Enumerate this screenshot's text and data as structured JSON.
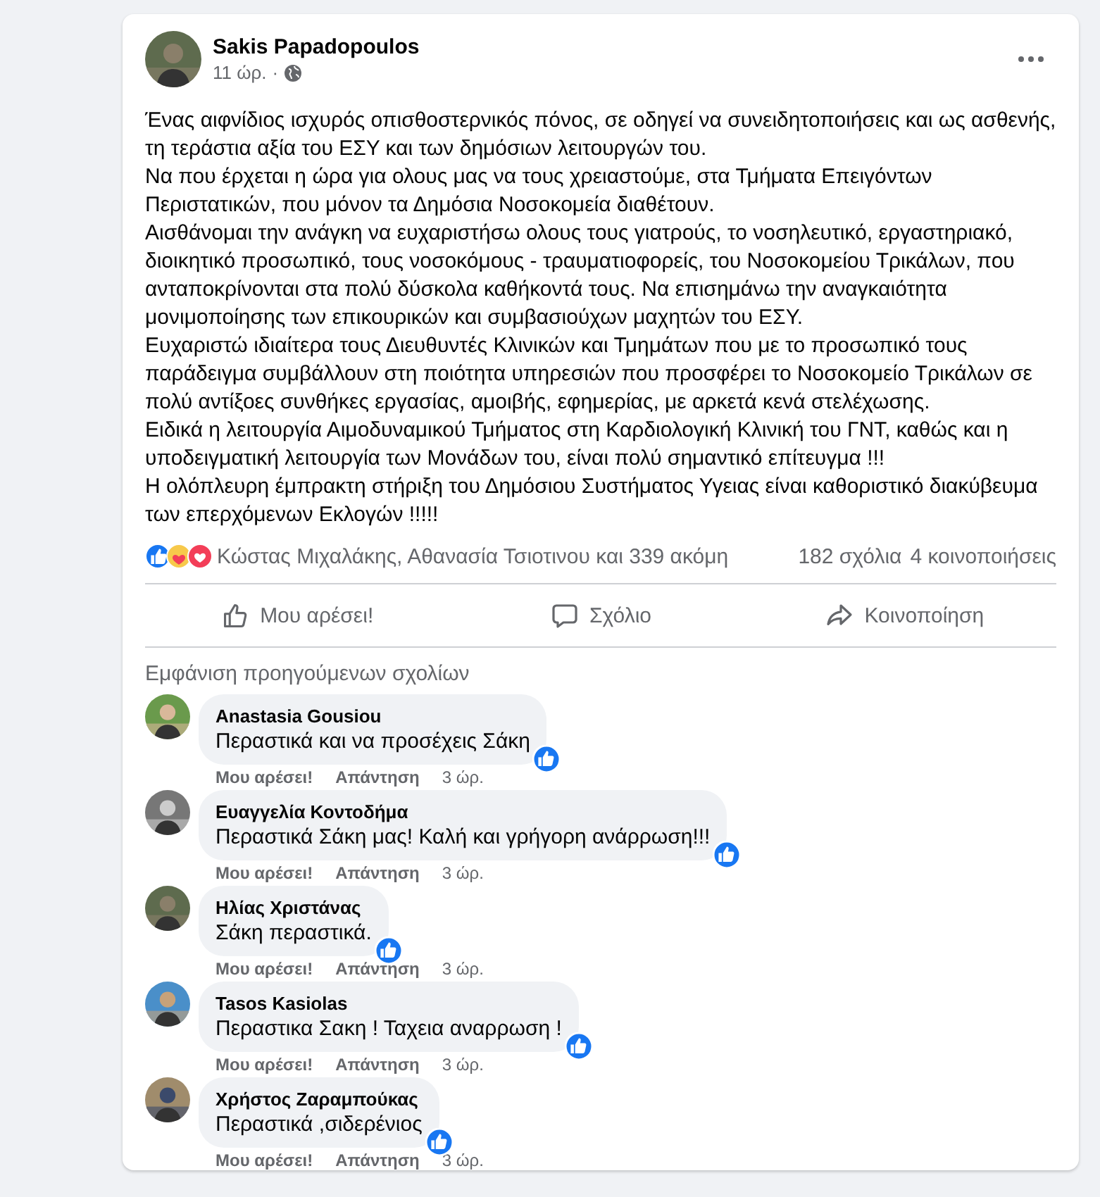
{
  "post": {
    "author": "Sakis Papadopoulos",
    "time": "11 ώρ.",
    "separator": "·",
    "paragraphs": [
      "Ένας αιφνίδιος ισχυρός οπισθοστερνικός πόνος, σε οδηγεί να συνειδητοποιήσεις και ως ασθενής, τη τεράστια αξία του ΕΣΥ και των δημόσιων λειτουργών του.",
      "Να που έρχεται η ώρα για ολους μας να τους χρειαστούμε, στα Τμήματα Επειγόντων Περιστατικών, που μόνον τα Δημόσια Νοσοκομεία διαθέτουν.",
      "Αισθάνομαι την ανάγκη να ευχαριστήσω ολους τους γιατρούς, το νοσηλευτικό, εργαστηριακό, διοικητικό προσωπικό, τους νοσοκόμους - τραυματιοφορείς, του Νοσοκομείου Τρικάλων, που ανταποκρίνονται στα πολύ δύσκολα καθήκοντά τους. Να επισημάνω την αναγκαιότητα μονιμοποίησης των επικουρικών και συμβασιούχων μαχητών του ΕΣΥ.",
      "Ευχαριστώ ιδιαίτερα τους Διευθυντές Κλινικών και Τμημάτων που με το προσωπικό τους παράδειγμα συμβάλλουν στη ποιότητα υπηρεσιών που προσφέρει το Νοσοκομείο Τρικάλων σε πολύ αντίξοες συνθήκες εργασίας, αμοιβής, εφημερίας, με αρκετά κενά στελέχωσης.",
      "Ειδικά η λειτουργία Αιμοδυναμικού Τμήματος στη Καρδιολογική Κλινική του ΓΝΤ, καθώς και η υποδειγματική λειτουργία των Μονάδων του, είναι πολύ σημαντικό επίτευγμα !!!",
      "Η ολόπλευρη έμπρακτη στήριξη του Δημόσιου Συστήματος Υγειας είναι καθοριστικό διακύβευμα των επερχόμενων Εκλογών !!!!!"
    ],
    "reactions": {
      "icons": [
        {
          "kind": "like"
        },
        {
          "kind": "care"
        },
        {
          "kind": "love"
        }
      ],
      "names": "Κώστας Μιχαλάκης, Αθανασία Τσιοτινου και 339 ακόμη",
      "comments": "182 σχόλια",
      "shares": "4 κοινοποιήσεις"
    },
    "actions": [
      {
        "kind": "like",
        "label": "Μου αρέσει!"
      },
      {
        "kind": "comment",
        "label": "Σχόλιο"
      },
      {
        "kind": "share",
        "label": "Κοινοποίηση"
      }
    ]
  },
  "previous_comments_link": "Εμφάνιση προηγούμενων σχολίων",
  "comments": [
    {
      "author": "Anastasia Gousiou",
      "text": "Περαστικά και να προσέχεις Σάκη",
      "like": "Μου αρέσει!",
      "reply": "Απάντηση",
      "time": "3 ώρ."
    },
    {
      "author": "Ευαγγελία Κοντοδήμα",
      "text": "Περαστικά Σάκη μας! Καλή και γρήγορη ανάρρωση!!!",
      "like": "Μου αρέσει!",
      "reply": "Απάντηση",
      "time": "3 ώρ."
    },
    {
      "author": "Ηλίας Χριστάνας",
      "text": "Σάκη περαστικά.",
      "like": "Μου αρέσει!",
      "reply": "Απάντηση",
      "time": "3 ώρ."
    },
    {
      "author": "Tasos Kasiolas",
      "text": "Περαστικα Σακη ! Ταχεια αναρρωση !",
      "like": "Μου αρέσει!",
      "reply": "Απάντηση",
      "time": "3 ώρ."
    },
    {
      "author": "Χρήστος Ζαραμπούκας",
      "text": "Περαστικά ,σιδερένιος",
      "like": "Μου αρέσει!",
      "reply": "Απάντηση",
      "time": "3 ώρ."
    }
  ]
}
